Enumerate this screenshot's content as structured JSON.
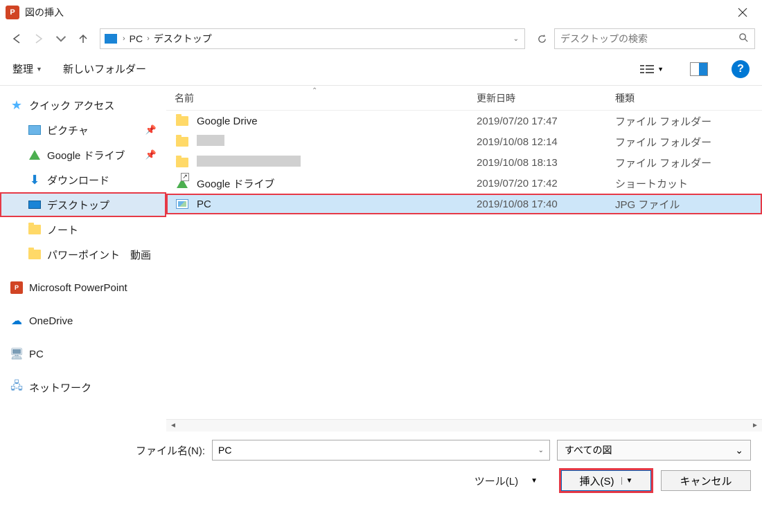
{
  "window": {
    "title": "図の挿入"
  },
  "breadcrumb": {
    "items": [
      "PC",
      "デスクトップ"
    ]
  },
  "search": {
    "placeholder": "デスクトップの検索"
  },
  "toolbar": {
    "organize": "整理",
    "newFolder": "新しいフォルダー"
  },
  "sidebar": {
    "quickAccess": "クイック アクセス",
    "pictures": "ピクチャ",
    "gdrive": "Google ドライブ",
    "downloads": "ダウンロード",
    "desktop": "デスクトップ",
    "notes": "ノート",
    "pptMovie": "パワーポイント　動画",
    "msppt": "Microsoft PowerPoint",
    "onedrive": "OneDrive",
    "pc": "PC",
    "network": "ネットワーク"
  },
  "columns": {
    "name": "名前",
    "date": "更新日時",
    "type": "種類"
  },
  "files": [
    {
      "name": "Google Drive",
      "date": "2019/07/20 17:47",
      "type": "ファイル フォルダー",
      "icon": "folder"
    },
    {
      "name": "",
      "date": "2019/10/08 12:14",
      "type": "ファイル フォルダー",
      "icon": "folder",
      "redactW": 40
    },
    {
      "name": "",
      "date": "2019/10/08 18:13",
      "type": "ファイル フォルダー",
      "icon": "folder",
      "redactW": 150
    },
    {
      "name": "Google ドライブ",
      "date": "2019/07/20 17:42",
      "type": "ショートカット",
      "icon": "shortcut-gdrive"
    },
    {
      "name": "PC",
      "date": "2019/10/08 17:40",
      "type": "JPG ファイル",
      "icon": "image",
      "selected": true
    }
  ],
  "footer": {
    "fileNameLabel": "ファイル名(N):",
    "fileNameValue": "PC",
    "filterValue": "すべての図",
    "tools": "ツール(L)",
    "insert": "挿入(S)",
    "cancel": "キャンセル"
  }
}
